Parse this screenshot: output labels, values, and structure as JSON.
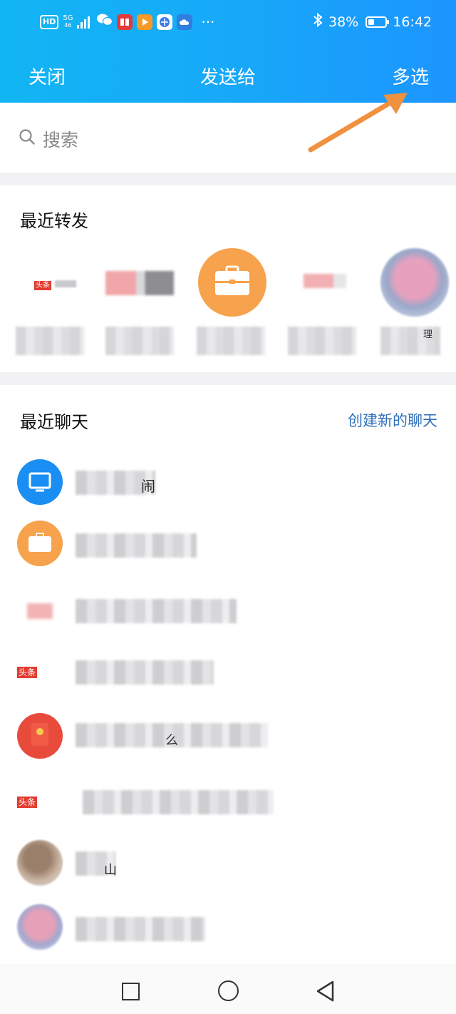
{
  "status_bar": {
    "hd_badge": "HD",
    "network_label": "5G",
    "network_sub": "46",
    "apps": [
      "book-app",
      "video-app",
      "browser-app",
      "cloud-app"
    ],
    "more": "···",
    "battery_percent": "38%",
    "time": "16:42",
    "battery_level": 0.38
  },
  "header": {
    "close_label": "关闭",
    "title": "发送给",
    "multi_select_label": "多选"
  },
  "search": {
    "placeholder": "搜索"
  },
  "recent_forward": {
    "title": "最近转发"
  },
  "recent_chats": {
    "title": "最近聊天",
    "create_label": "创建新的聊天",
    "rows": 8
  },
  "overlay": {
    "snippet": "头条",
    "snippet_row_1_tail": "闹",
    "snippet_row_5_tail": "么",
    "snippet_row_7_tail": "山",
    "forward_5_tail": "理"
  },
  "colors": {
    "header_start": "#12b5f4",
    "header_end": "#1c95ff",
    "accent_link": "#2f6fb8",
    "annotation_arrow": "#f0913f",
    "avatar_orange": "#f7a24c",
    "avatar_blue": "#1a8ef2"
  }
}
